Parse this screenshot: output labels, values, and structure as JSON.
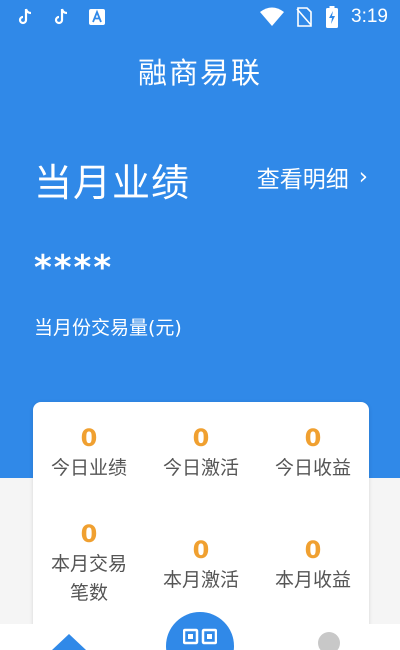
{
  "status_bar": {
    "time": "3:19",
    "left_icons": [
      "tiktok-icon",
      "tiktok-icon",
      "text-a-icon"
    ],
    "right_icons": [
      "wifi-icon",
      "no-sim-icon",
      "battery-charging-icon"
    ]
  },
  "header": {
    "title": "融商易联"
  },
  "performance": {
    "title": "当月业绩",
    "view_detail_label": "查看明细",
    "view_detail_arrow": "›",
    "masked_value": "****",
    "volume_label": "当月份交易量(元)"
  },
  "stats": [
    {
      "value": "0",
      "label": "今日业绩"
    },
    {
      "value": "0",
      "label": "今日激活"
    },
    {
      "value": "0",
      "label": "今日收益"
    },
    {
      "value": "0",
      "label": "本月交易笔数"
    },
    {
      "value": "0",
      "label": "本月激活"
    },
    {
      "value": "0",
      "label": "本月收益"
    }
  ],
  "bottom_nav": {
    "items": [
      "home-icon",
      "scan-icon",
      "profile-icon"
    ]
  },
  "colors": {
    "primary": "#3089e8",
    "accent_value": "#f0a030",
    "label": "#555555"
  }
}
